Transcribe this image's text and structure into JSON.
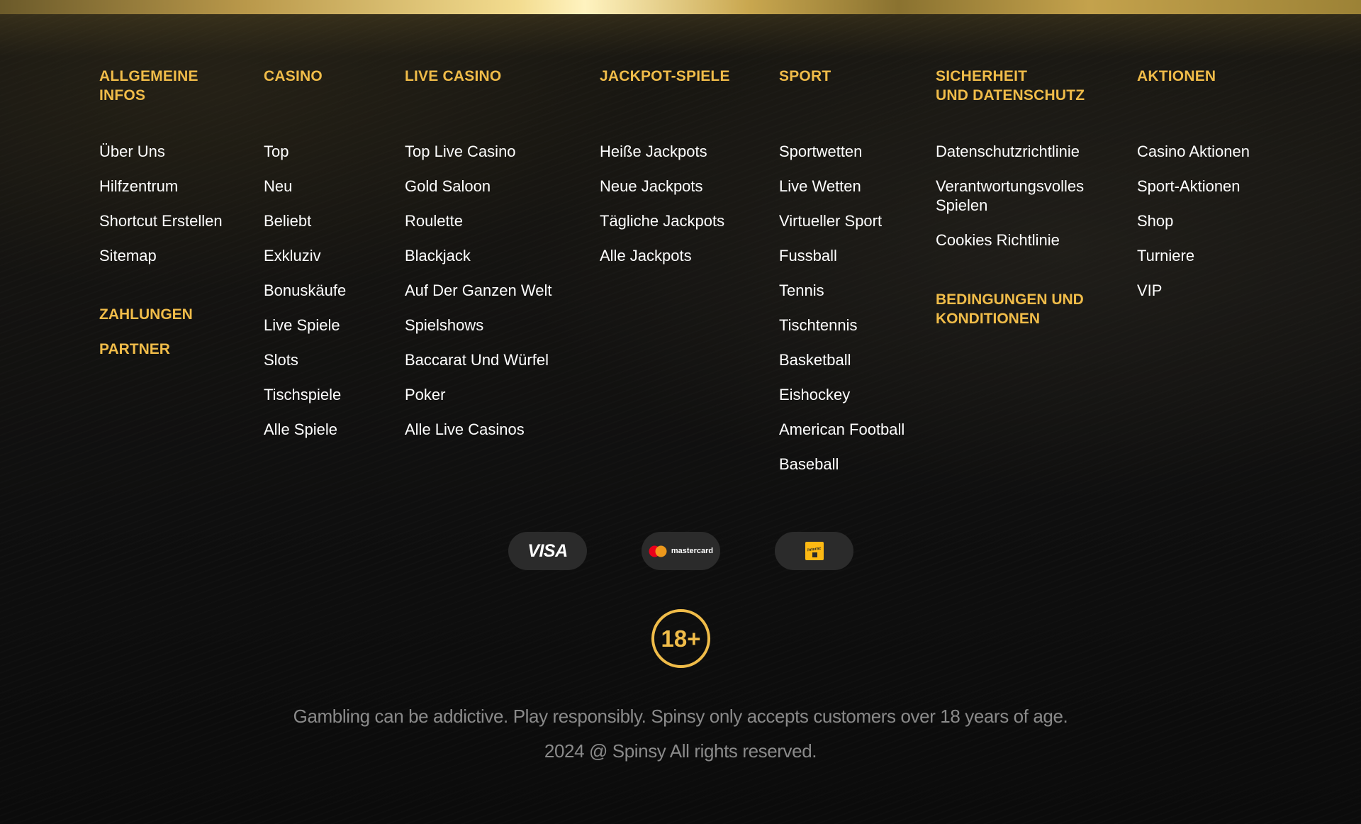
{
  "colors": {
    "accent": "#f0bc49",
    "background": "#0c0c0c",
    "text": "#ffffff",
    "muted": "#8a8a8a",
    "pill": "#2b2b2b"
  },
  "columns": {
    "general": {
      "heading_line1": "ALLGEMEINE",
      "heading_line2": "INFOS",
      "links": [
        "Über Uns",
        "Hilfzentrum",
        "Shortcut Erstellen",
        "Sitemap"
      ],
      "sub1": "ZAHLUNGEN",
      "sub2": "PARTNER"
    },
    "casino": {
      "heading": "CASINO",
      "links": [
        "Top",
        "Neu",
        "Beliebt",
        "Exkluziv",
        "Bonuskäufe",
        "Live Spiele",
        "Slots",
        "Tischspiele",
        "Alle Spiele"
      ]
    },
    "live_casino": {
      "heading": "LIVE CASINO",
      "links": [
        "Top Live Casino",
        "Gold Saloon",
        "Roulette",
        "Blackjack",
        "Auf Der Ganzen Welt",
        "Spielshows",
        "Baccarat Und Würfel",
        "Poker",
        "Alle Live Casinos"
      ]
    },
    "jackpot": {
      "heading": "JACKPOT-SPIELE",
      "links": [
        "Heiße Jackpots",
        "Neue Jackpots",
        "Tägliche Jackpots",
        "Alle Jackpots"
      ]
    },
    "sport": {
      "heading": "SPORT",
      "links": [
        "Sportwetten",
        "Live Wetten",
        "Virtueller Sport",
        "Fussball",
        "Tennis",
        "Tischtennis",
        "Basketball",
        "Eishockey",
        "American Football",
        "Baseball"
      ]
    },
    "security": {
      "heading_line1": "SICHERHEIT",
      "heading_line2": "UND DATENSCHUTZ",
      "links": [
        "Datenschutzrichtlinie",
        "Verantwortungsvolles Spielen",
        "Cookies Richtlinie"
      ],
      "sub_line1": "BEDINGUNGEN UND",
      "sub_line2": "KONDITIONEN"
    },
    "promotions": {
      "heading": "AKTIONEN",
      "links": [
        "Casino Aktionen",
        "Sport-Aktionen",
        "Shop",
        "Turniere",
        "VIP"
      ]
    }
  },
  "payments": {
    "visa": "VISA",
    "mastercard": "mastercard",
    "interac": "Interac"
  },
  "age_badge": "18+",
  "disclaimer": "Gambling can be addictive. Play responsibly. Spinsy only accepts customers over 18 years of age.",
  "copyright": "2024 @ Spinsy All rights reserved.",
  "icons": [
    "visa-logo-icon",
    "mastercard-logo-icon",
    "interac-logo-icon",
    "age-18-badge-icon"
  ]
}
